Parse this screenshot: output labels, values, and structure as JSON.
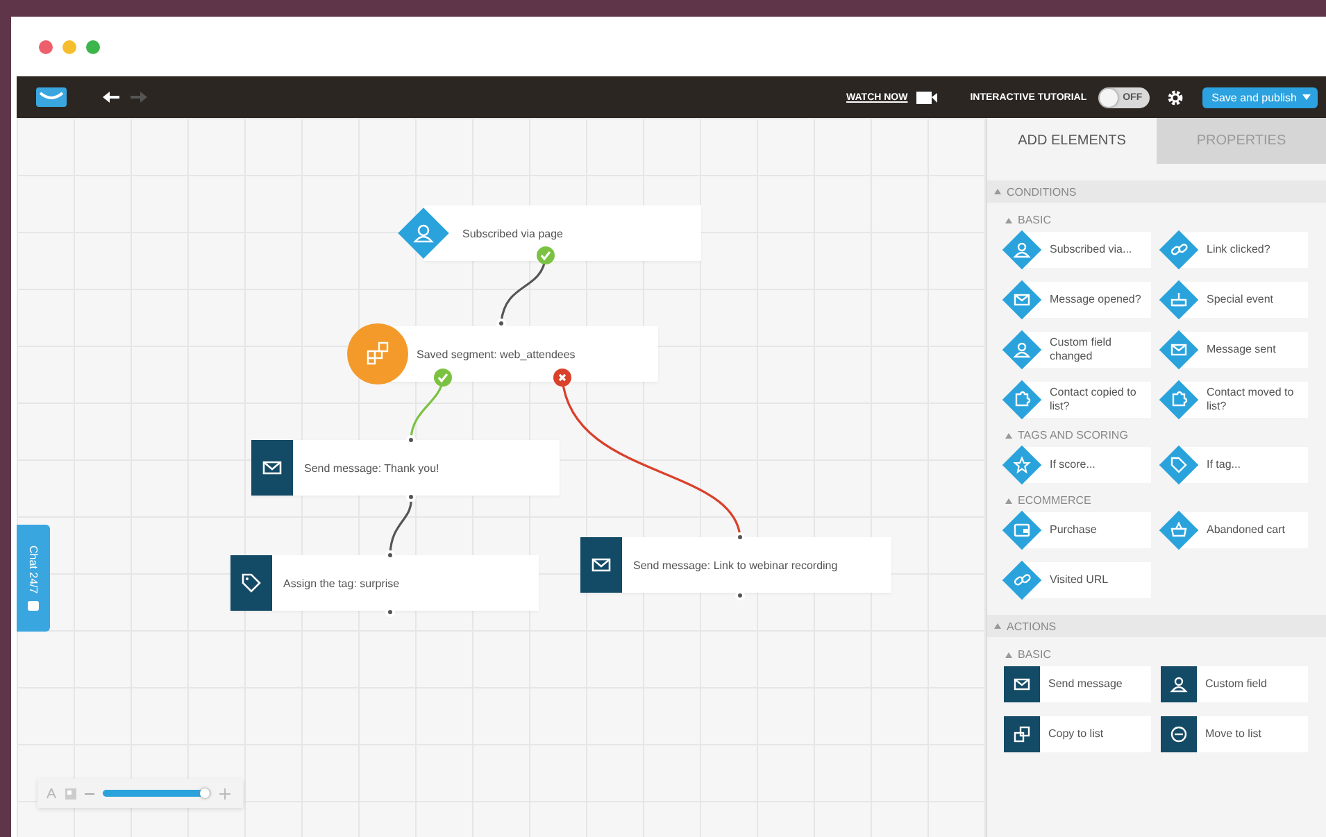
{
  "window": {
    "controls": [
      {
        "kind": "close"
      },
      {
        "kind": "minimize"
      },
      {
        "kind": "zoom"
      }
    ]
  },
  "toolbar": {
    "watch_now": "WATCH NOW",
    "tutorial_label": "INTERACTIVE TUTORIAL",
    "tutorial_toggle": {
      "label": "OFF",
      "on": false
    },
    "publish_button": "Save and publish"
  },
  "canvas": {
    "nodes": [
      {
        "kind": "condition",
        "label": "Subscribed via page"
      },
      {
        "kind": "segment",
        "label": "Saved segment: web_attendees"
      },
      {
        "kind": "message",
        "label": "Send message: Thank you!"
      },
      {
        "kind": "tag",
        "label": "Assign the tag: surprise"
      },
      {
        "kind": "message",
        "label": "Send message: Link to webinar recording"
      }
    ],
    "connections": [
      {
        "kind": "yes"
      },
      {
        "kind": "yes"
      },
      {
        "kind": "no"
      },
      {
        "kind": "plain"
      }
    ],
    "chat_tab": "Chat 24/7",
    "zoom": {
      "level": 0.95
    }
  },
  "sidebar": {
    "tabs": [
      {
        "label": "ADD ELEMENTS",
        "selected": true
      },
      {
        "label": "PROPERTIES",
        "selected": false
      }
    ],
    "sections": [
      {
        "title": "CONDITIONS",
        "groups": [
          {
            "title": "BASIC",
            "items": [
              "Subscribed via...",
              "Link clicked?",
              "Message opened?",
              "Special event",
              "Custom field changed",
              "Message sent",
              "Contact copied to list?",
              "Contact moved to list?"
            ]
          },
          {
            "title": "TAGS AND SCORING",
            "items": [
              "If score...",
              "If tag..."
            ]
          },
          {
            "title": "ECOMMERCE",
            "items": [
              "Purchase",
              "Abandoned cart",
              "Visited URL"
            ]
          }
        ]
      },
      {
        "title": "ACTIONS",
        "groups": [
          {
            "title": "BASIC",
            "items": [
              "Send message",
              "Custom field",
              "Copy to list",
              "Move to list"
            ]
          }
        ]
      }
    ]
  }
}
